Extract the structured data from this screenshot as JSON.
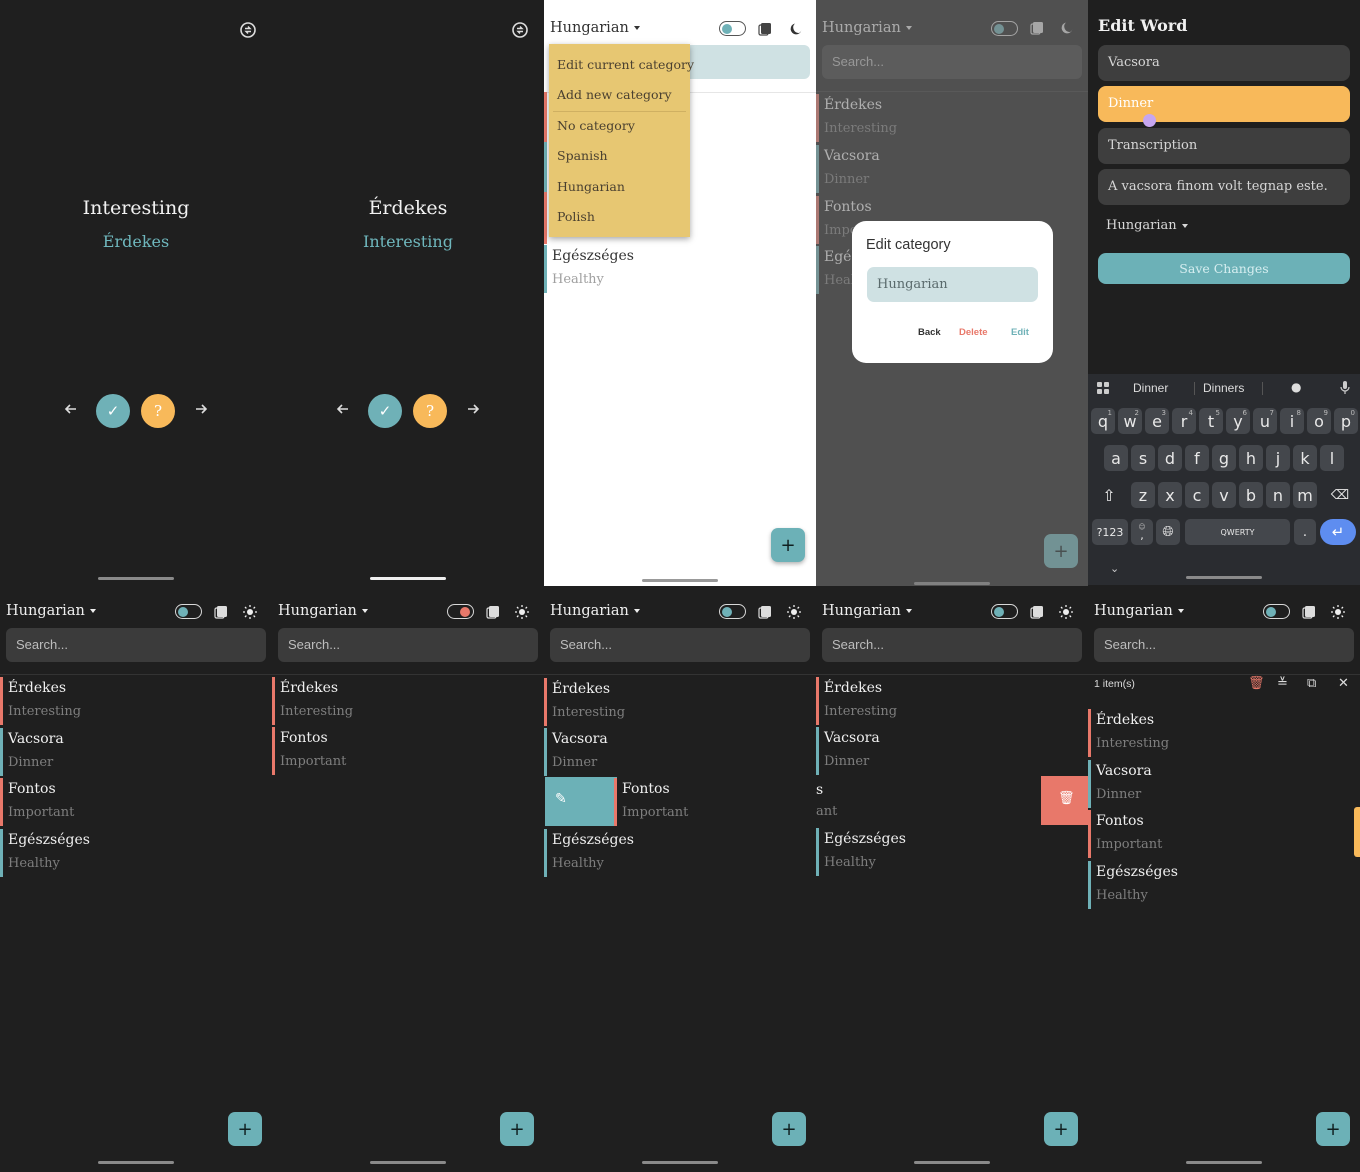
{
  "colors": {
    "teal": "#6fb1b7",
    "orange": "#f8b95a",
    "red": "#e8786a",
    "menu": "#e7c772",
    "dark": "#1f1f1f",
    "blue": "#5e8df0"
  },
  "flashcards": [
    {
      "front": "Interesting",
      "back": "Érdekes"
    },
    {
      "front": "Érdekes",
      "back": "Interesting"
    }
  ],
  "header": {
    "language": "Hungarian",
    "search_placeholder": "Search..."
  },
  "words": [
    {
      "word": "Érdekes",
      "translation": "Interesting"
    },
    {
      "word": "Vacsora",
      "translation": "Dinner"
    },
    {
      "word": "Fontos",
      "translation": "Important"
    },
    {
      "word": "Egészséges",
      "translation": "Healthy"
    }
  ],
  "menu": {
    "items": [
      "Edit current category",
      "Add new category",
      "No category",
      "Spanish",
      "Hungarian",
      "Polish"
    ]
  },
  "dialog": {
    "title": "Edit category",
    "value": "Hungarian",
    "back": "Back",
    "delete": "Delete",
    "edit": "Edit"
  },
  "edit_word": {
    "title": "Edit Word",
    "word": "Vacsora",
    "translation": "Dinner",
    "transcription": "Transcription",
    "example": "A vacsora finom volt tegnap este.",
    "category": "Hungarian",
    "save": "Save Changes"
  },
  "keyboard": {
    "suggestions": [
      "Dinner",
      "Dinners"
    ],
    "row1": [
      "q",
      "w",
      "e",
      "r",
      "t",
      "y",
      "u",
      "i",
      "o",
      "p"
    ],
    "row1_nums": [
      "1",
      "2",
      "3",
      "4",
      "5",
      "6",
      "7",
      "8",
      "9",
      "0"
    ],
    "row2": [
      "a",
      "s",
      "d",
      "f",
      "g",
      "h",
      "j",
      "k",
      "l"
    ],
    "row3": [
      "z",
      "x",
      "c",
      "v",
      "b",
      "n",
      "m"
    ],
    "sym": "?123",
    "space": "QWERTY",
    "period": ".",
    "comma_hint": "☺",
    "comma": ","
  },
  "selection": {
    "count": "1 item(s)"
  },
  "swipe": {
    "partial_word": "s",
    "partial_translation": "ant"
  },
  "icons": {
    "refresh": "refresh-icon",
    "check": "check-icon",
    "question": "question-icon",
    "plus": "plus-icon",
    "pencil": "pencil-icon",
    "trash": "trash-icon",
    "moon": "moon-icon",
    "sun": "sun-icon",
    "cards": "flashcards-icon"
  }
}
